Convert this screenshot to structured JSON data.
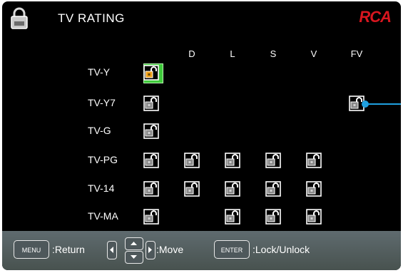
{
  "header": {
    "title": "TV RATING",
    "brand": "RCA",
    "icon": "lock-icon"
  },
  "columns": [
    "D",
    "L",
    "S",
    "V",
    "FV"
  ],
  "rows": [
    {
      "label": "TV-Y",
      "cells": [
        true,
        false,
        false,
        false,
        false,
        false
      ]
    },
    {
      "label": "TV-Y7",
      "cells": [
        true,
        false,
        false,
        false,
        false,
        true
      ]
    },
    {
      "label": "TV-G",
      "cells": [
        true,
        false,
        false,
        false,
        false,
        false
      ]
    },
    {
      "label": "TV-PG",
      "cells": [
        true,
        true,
        true,
        true,
        true,
        false
      ]
    },
    {
      "label": "TV-14",
      "cells": [
        true,
        true,
        true,
        true,
        true,
        false
      ]
    },
    {
      "label": "TV-MA",
      "cells": [
        true,
        false,
        true,
        true,
        true,
        false
      ]
    }
  ],
  "selected": {
    "row": 0,
    "col": 0
  },
  "footer": {
    "menu_key": "MENU",
    "menu_label": ":Return",
    "move_label": ":Move",
    "enter_key": "ENTER",
    "enter_label": ":Lock/Unlock"
  },
  "colors": {
    "selected_bg": "#3ec93a",
    "lock_selected": "#f0a21c",
    "brand": "#d8161f",
    "pointer": "#1fa0e0"
  }
}
